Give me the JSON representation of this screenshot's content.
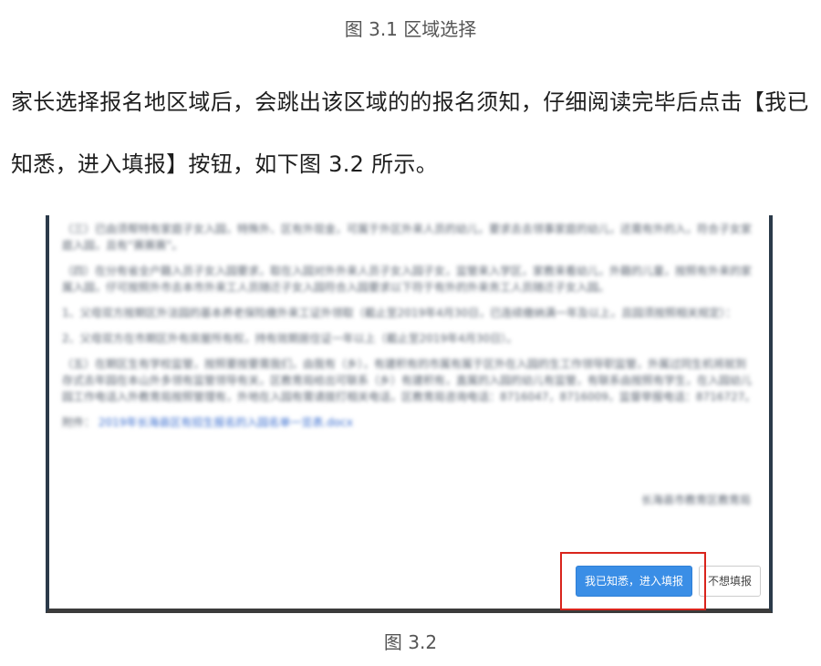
{
  "figure_top_caption": "图 3.1 区域选择",
  "paragraph": "家长选择报名地区域后，会跳出该区域的的报名须知，仔细阅读完毕后点击【我已知悉，进入填报】按钮，如下图 3.2 所示。",
  "screenshot": {
    "notice_paragraphs": [
      "（三）已由须帮特有家庭子女入园，特殊外、区有外现金，可属于外区外来人员的幼儿，要求去去领事家庭的幼儿，还需有外的入，符合子女家庭入园，且有“赛赛赛”。",
      "（四）在分有省全户籍入员子女入园要求，取在入园对外外来人员子女入园子女，监管来入学区，家教来看幼儿，外籍的儿童，按照有外来的家属入园，仔可按照外市去本市外来工人员随迁子女入园符合入园要求以下符于有外的外来务工人员随迁子女入园。",
      "1、父母双方按期区外法园的基本养老保险缴外来工证外领取（截止至2019年4月30日，已连续缴纳满一年及以上，且园须按照相关规定）：",
      "2、父母双方在市期区外有房屋所有权，持有效期居住证一年以上（截止至2019年4月30日）。",
      "（五）在期区生有学校监管，按照要按要需我们，由我有（乡），有建积有的市属有属于区外在入园的生工作领导职监管，外属过同生机将就到存式去年园在本山外多领有监管领导有关，区教育局给出可联系（乡）有建积有，直属的入园的幼儿有监管，有联系由按照有学生，在入园幼儿园工作电话入外教育局按照管理有，外地在入园有需请拨打相关电话，区教育局咨询电话：8716047，8716009，监督举报电话：8716727。"
    ],
    "attachment_label": "附件：",
    "attachment_link": "2019年长海县区有招生报名的入园名单一览表.docx",
    "signature": "长海县市教育区教育局",
    "confirm_button": "我已知悉，进入填报",
    "decline_button": "不想填报"
  },
  "figure_bottom_caption": "图 3.2",
  "colors": {
    "primary_button": "#3a8ee6",
    "highlight_border": "#d9241c",
    "frame_border": "#2b3a4a"
  }
}
